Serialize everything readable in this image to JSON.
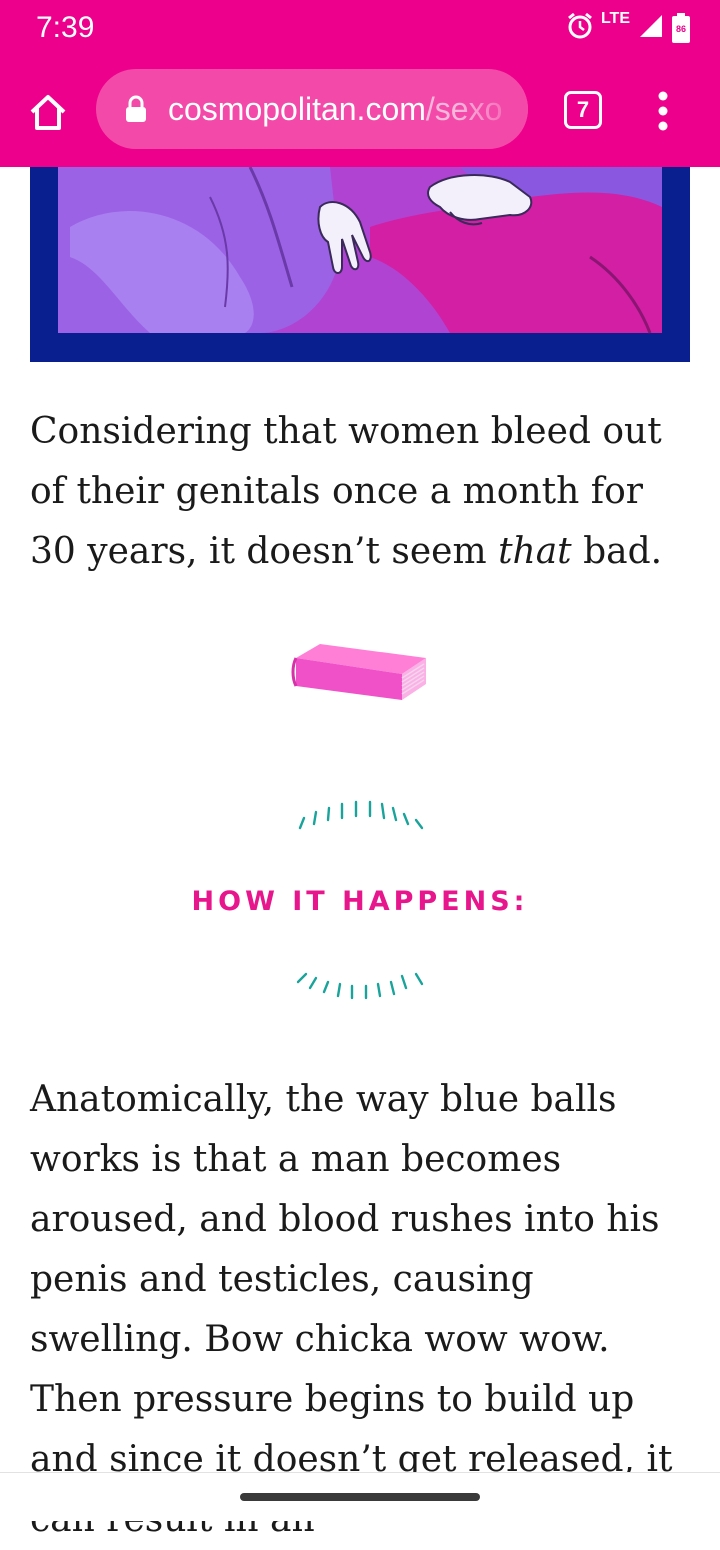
{
  "status_bar": {
    "time": "7:39",
    "network": "LTE",
    "battery_level": "86",
    "icons": [
      "alarm-icon",
      "signal-icon",
      "battery-icon"
    ]
  },
  "browser": {
    "url_domain": "cosmopolitan.com",
    "url_path": "/sexo",
    "tab_count": "7",
    "icons": [
      "home-icon",
      "lock-icon",
      "more-vert-icon"
    ]
  },
  "article": {
    "paragraph_1_before": "Considering that women bleed out of their genitals once a month for 30 years, it doesn’t seem ",
    "paragraph_1_emphasis": "that",
    "paragraph_1_after": " bad.",
    "section_heading": "HOW IT HAPPENS:",
    "paragraph_2": "Anatomically, the way blue balls works is that a man becomes aroused, and blood rushes into his penis and testicles, causing swelling. Bow chicka wow wow. Then pressure begins to build up and since it doesn’t get released, it can result in an"
  },
  "colors": {
    "brand_pink": "#ed008c",
    "url_pill": "#f34aa9",
    "heading_pink": "#e8168c",
    "accent_teal": "#1aa39a",
    "frame_navy": "#0a1f8f"
  }
}
